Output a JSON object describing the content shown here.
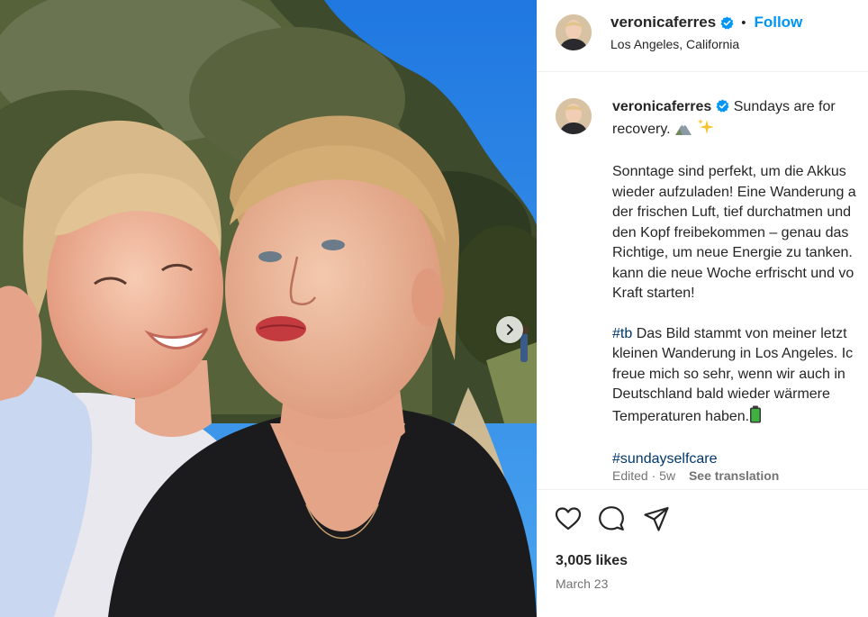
{
  "post": {
    "username": "veronicaferres",
    "follow_label": "Follow",
    "separator": "•",
    "location": "Los Angeles, California"
  },
  "caption": {
    "username": "veronicaferres",
    "first_text": "Sundays are for",
    "second_line": "recovery.",
    "emoji_names": [
      "mountain-emoji",
      "sparkles-emoji"
    ],
    "paragraph_1": [
      "Sonntage sind perfekt, um die Akkus",
      "wieder aufzuladen! Eine Wanderung a",
      "der frischen Luft, tief durchatmen und",
      "den Kopf freibekommen – genau das",
      "Richtige, um neue Energie zu tanken.",
      "kann die neue Woche erfrischt und vo",
      "Kraft starten!"
    ],
    "hashtag_tb": "#tb",
    "paragraph_2_first": " Das Bild stammt von meiner letzt",
    "paragraph_2_rest": [
      "kleinen Wanderung in Los Angeles. Ic",
      "freue mich so sehr, wenn wir auch in",
      "Deutschland bald wieder wärmere"
    ],
    "paragraph_2_last": "Temperaturen haben.",
    "battery_emoji": "battery-emoji",
    "hashtag_selfcare": "#sundayselfcare"
  },
  "meta": {
    "edited": "Edited",
    "dot": "·",
    "age": "5w",
    "translate_label": "See translation"
  },
  "actions": {
    "icons": [
      "heart-icon",
      "comment-icon",
      "share-icon"
    ]
  },
  "stats": {
    "likes": "3,005 likes",
    "date": "March 23"
  },
  "colors": {
    "link_blue": "#0095f6",
    "hashtag_blue": "#00376b",
    "verified_blue": "#0095f6",
    "text": "#262626",
    "muted": "#737373"
  }
}
